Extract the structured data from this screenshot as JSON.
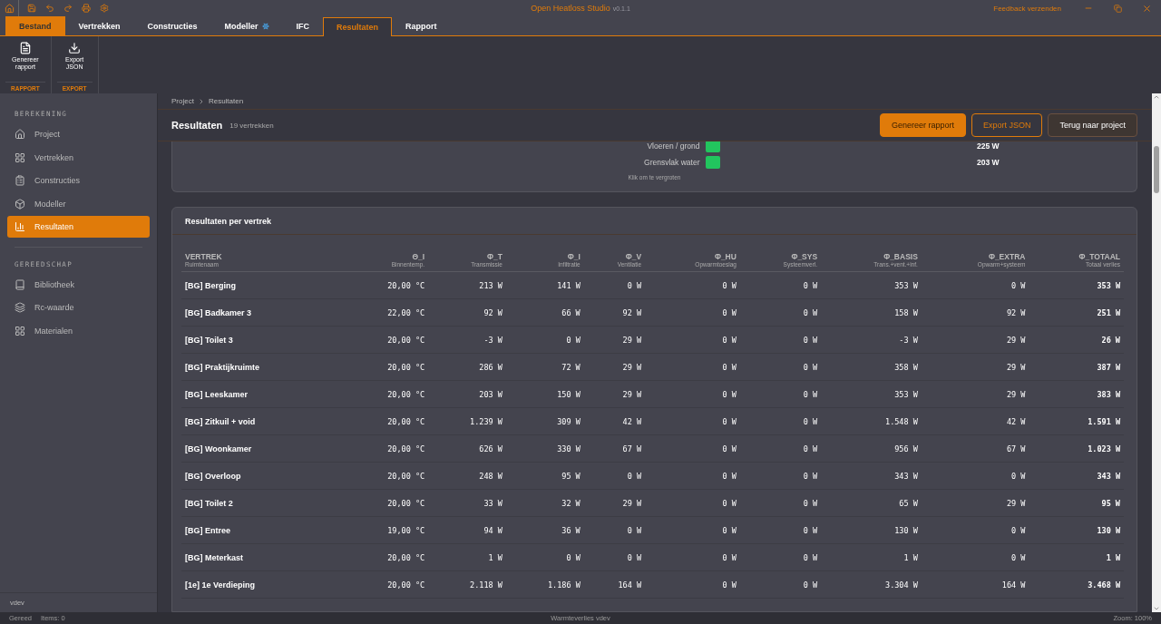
{
  "window": {
    "title": "Open Heatloss Studio",
    "version": "v0.1.1",
    "feedback": "Feedback verzenden"
  },
  "tabs": [
    {
      "label": "Bestand",
      "kind": "file",
      "selected": false
    },
    {
      "label": "Vertrekken",
      "kind": "tab",
      "selected": false
    },
    {
      "label": "Constructies",
      "kind": "tab",
      "selected": false
    },
    {
      "label": "Modeller",
      "kind": "tab-snow",
      "selected": false
    },
    {
      "label": "IFC",
      "kind": "tab",
      "selected": false
    },
    {
      "label": "Resultaten",
      "kind": "tab",
      "selected": true
    },
    {
      "label": "Rapport",
      "kind": "tab",
      "selected": false
    }
  ],
  "ribbon": [
    {
      "group": "RAPPORT",
      "buttons": [
        {
          "label": "Genereer rapport",
          "kind": "file"
        }
      ]
    },
    {
      "group": "EXPORT",
      "buttons": [
        {
          "label": "Export JSON",
          "kind": "download"
        }
      ]
    }
  ],
  "sidebar": {
    "sections": [
      {
        "title": "BEREKENING",
        "items": [
          {
            "label": "Project",
            "kind": "home",
            "selected": false
          },
          {
            "label": "Vertrekken",
            "kind": "grid",
            "selected": false
          },
          {
            "label": "Constructies",
            "kind": "clipboard",
            "selected": false
          },
          {
            "label": "Modeller",
            "kind": "box",
            "selected": false
          },
          {
            "label": "Resultaten",
            "kind": "chart",
            "selected": true
          }
        ]
      },
      {
        "title": "GEREEDSCHAP",
        "items": [
          {
            "label": "Bibliotheek",
            "kind": "book",
            "selected": false
          },
          {
            "label": "Rc-waarde",
            "kind": "layers",
            "selected": false
          },
          {
            "label": "Materialen",
            "kind": "grid",
            "selected": false
          }
        ]
      }
    ],
    "footer": "vdev"
  },
  "breadcrumb": [
    "Project",
    "Resultaten"
  ],
  "header": {
    "title": "Resultaten",
    "count": "19 vertrekken",
    "buttons": [
      {
        "label": "Genereer rapport",
        "kind": "primary"
      },
      {
        "label": "Export JSON",
        "kind": "outline"
      },
      {
        "label": "Terug naar project",
        "kind": "secondary"
      }
    ]
  },
  "legend": {
    "items": [
      {
        "label": "Vloeren / grond",
        "color": "#22c55e",
        "value": "225 W"
      },
      {
        "label": "Grensvlak water",
        "color": "#22c55e",
        "value": "203 W"
      }
    ],
    "hint": "Klik om te vergroten"
  },
  "table": {
    "title": "Resultaten per vertrek",
    "columns": [
      {
        "label": "VERTREK",
        "sub": "Ruimtenaam"
      },
      {
        "label": "Θ_I",
        "sub": "Binnentemp."
      },
      {
        "label": "Φ_T",
        "sub": "Transmissie"
      },
      {
        "label": "Φ_I",
        "sub": "Infiltratie"
      },
      {
        "label": "Φ_V",
        "sub": "Ventilatie"
      },
      {
        "label": "Φ_HU",
        "sub": "Opwarmtoeslag"
      },
      {
        "label": "Φ_SYS",
        "sub": "Systeemverl."
      },
      {
        "label": "Φ_BASIS",
        "sub": "Trans.+vent.+inf."
      },
      {
        "label": "Φ_EXTRA",
        "sub": "Opwarm+systeem"
      },
      {
        "label": "Φ_TOTAAL",
        "sub": "Totaal verlies"
      }
    ],
    "rows": [
      [
        "[BG] Berging",
        "20,00 °C",
        "213 W",
        "141 W",
        "0 W",
        "0 W",
        "0 W",
        "353 W",
        "0 W",
        "353 W"
      ],
      [
        "[BG] Badkamer 3",
        "22,00 °C",
        "92 W",
        "66 W",
        "92 W",
        "0 W",
        "0 W",
        "158 W",
        "92 W",
        "251 W"
      ],
      [
        "[BG] Toilet 3",
        "20,00 °C",
        "-3 W",
        "0 W",
        "29 W",
        "0 W",
        "0 W",
        "-3 W",
        "29 W",
        "26 W"
      ],
      [
        "[BG] Praktijkruimte",
        "20,00 °C",
        "286 W",
        "72 W",
        "29 W",
        "0 W",
        "0 W",
        "358 W",
        "29 W",
        "387 W"
      ],
      [
        "[BG] Leeskamer",
        "20,00 °C",
        "203 W",
        "150 W",
        "29 W",
        "0 W",
        "0 W",
        "353 W",
        "29 W",
        "383 W"
      ],
      [
        "[BG] Zitkuil + void",
        "20,00 °C",
        "1.239 W",
        "309 W",
        "42 W",
        "0 W",
        "0 W",
        "1.548 W",
        "42 W",
        "1.591 W"
      ],
      [
        "[BG] Woonkamer",
        "20,00 °C",
        "626 W",
        "330 W",
        "67 W",
        "0 W",
        "0 W",
        "956 W",
        "67 W",
        "1.023 W"
      ],
      [
        "[BG] Overloop",
        "20,00 °C",
        "248 W",
        "95 W",
        "0 W",
        "0 W",
        "0 W",
        "343 W",
        "0 W",
        "343 W"
      ],
      [
        "[BG] Toilet 2",
        "20,00 °C",
        "33 W",
        "32 W",
        "29 W",
        "0 W",
        "0 W",
        "65 W",
        "29 W",
        "95 W"
      ],
      [
        "[BG] Entree",
        "19,00 °C",
        "94 W",
        "36 W",
        "0 W",
        "0 W",
        "0 W",
        "130 W",
        "0 W",
        "130 W"
      ],
      [
        "[BG] Meterkast",
        "20,00 °C",
        "1 W",
        "0 W",
        "0 W",
        "0 W",
        "0 W",
        "1 W",
        "0 W",
        "1 W"
      ],
      [
        "[1e] 1e Verdieping",
        "20,00 °C",
        "2.118 W",
        "1.186 W",
        "164 W",
        "0 W",
        "0 W",
        "3.304 W",
        "164 W",
        "3.468 W"
      ]
    ]
  },
  "status_bar": {
    "state": "Gereed",
    "items": "Items: 0",
    "center": "Warmteverlies vdev",
    "zoom": "Zoom: 100%"
  }
}
